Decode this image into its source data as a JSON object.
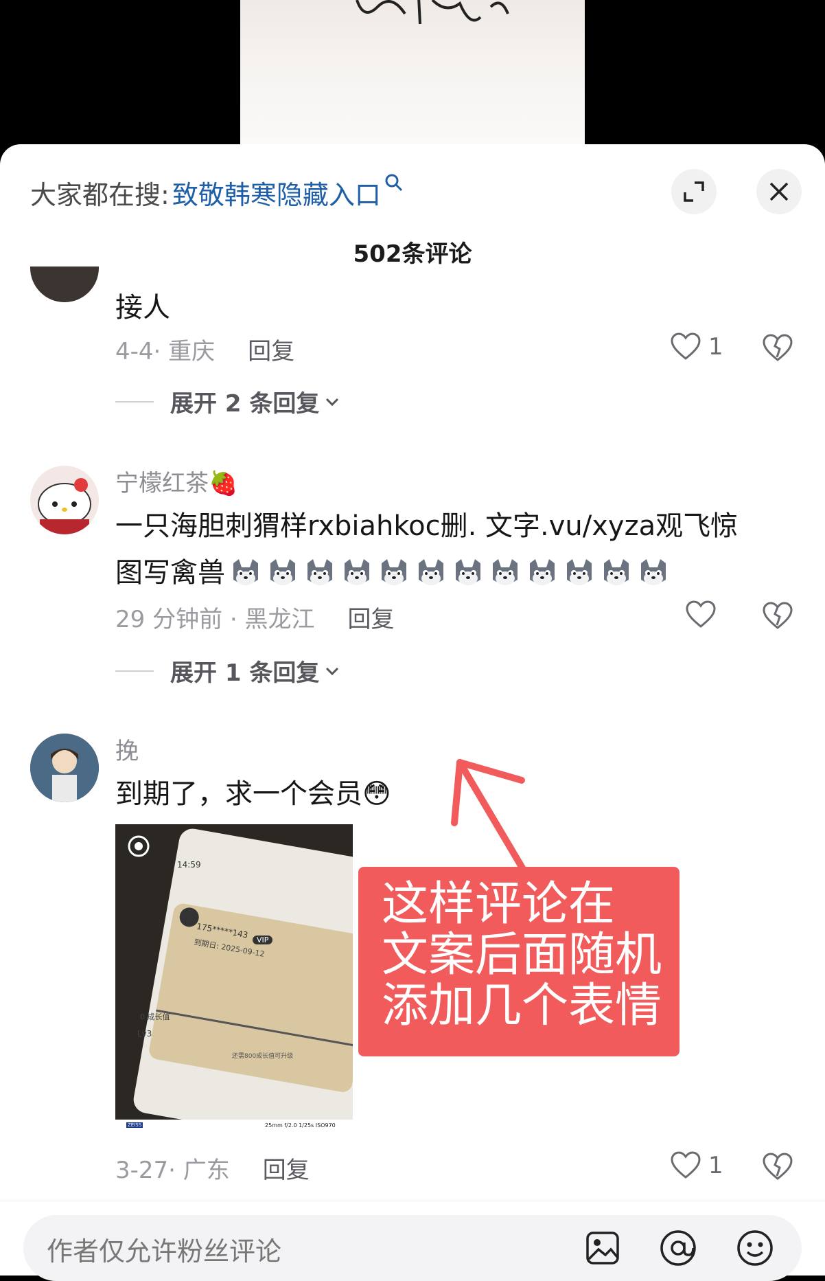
{
  "search": {
    "prefix": "大家都在搜:",
    "query": "致敬韩寒隐藏入口"
  },
  "header": {
    "comment_count": "502条评论"
  },
  "comments": [
    {
      "text_tail": "接人",
      "meta": "4-4· 重庆",
      "reply": "回复",
      "likes": "1",
      "expand": "展开 2 条回复"
    },
    {
      "username": "宁檬红茶🍓",
      "text_line1": "一只海胆刺猬样rxbiahkoc删.        文字.vu/xyza观飞惊",
      "text_line2": "图写禽兽",
      "meta": "29 分钟前 · 黑龙江",
      "reply": "回复",
      "expand": "展开 1 条回复"
    },
    {
      "username": "挽",
      "text": "到期了，求一个会员😳",
      "meta": "3-27· 广东",
      "reply": "回复",
      "likes": "1",
      "photo": {
        "time": "14:59",
        "phone": "175*****143",
        "vip": "VIP",
        "expiry": "到期日: 2025-09-12",
        "growth": "0 成长值",
        "level": "Lv3",
        "hint": "还需800成长值可升级",
        "brand": "ZEISS",
        "exif": "25mm f/2.0 1/25s ISO970"
      }
    }
  ],
  "annotation": {
    "lines": [
      "这样评论在",
      "文案后面随机",
      "添加几个表情"
    ]
  },
  "input": {
    "placeholder": "作者仅允许粉丝评论"
  },
  "colors": {
    "link": "#1f5fa8",
    "annotation_bg": "#f25b5b",
    "arrow": "#f25b5b"
  }
}
